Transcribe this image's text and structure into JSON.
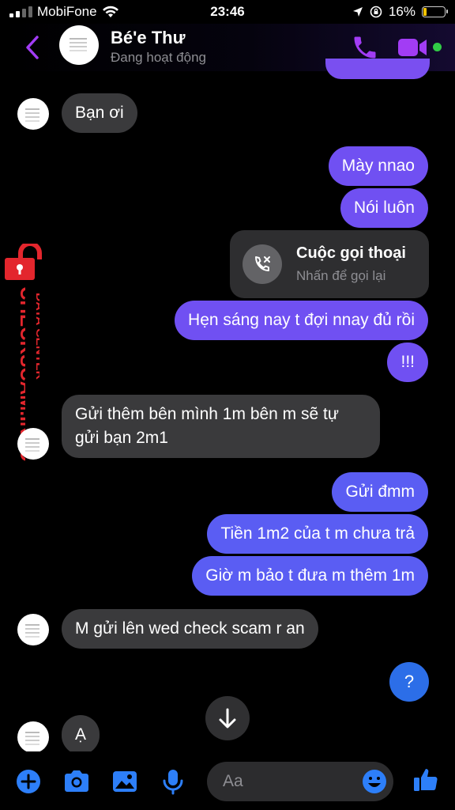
{
  "status_bar": {
    "carrier": "MobiFone",
    "time": "23:46",
    "battery": "16%",
    "battery_color": "#f5c400",
    "icons": [
      "signal-icon",
      "wifi-icon",
      "location-icon",
      "orientation-lock-icon",
      "battery-icon"
    ]
  },
  "header": {
    "name": "Bé'e Thư",
    "status": "Đang hoạt động",
    "accent": "#a23cf5",
    "online_color": "#31cc46",
    "icons": [
      "back-icon",
      "phone-icon",
      "video-icon"
    ]
  },
  "messages": [
    {
      "side": "in",
      "text": "Bạn ơi"
    },
    {
      "side": "out",
      "text": "Mày nnao"
    },
    {
      "side": "out",
      "text": "Nói luôn"
    },
    {
      "side": "out",
      "type": "call",
      "title": "Cuộc gọi thoại",
      "subtitle": "Nhấn để gọi lại"
    },
    {
      "side": "out",
      "text": "Hẹn sáng nay t đợi nnay đủ rồi"
    },
    {
      "side": "out",
      "text": "!!!"
    },
    {
      "side": "in",
      "lines": [
        "Gửi thêm bên mình 1m bên m sẽ tự",
        "gửi bạn 2m1"
      ]
    },
    {
      "side": "out",
      "text": "Gửi đmm"
    },
    {
      "side": "out",
      "text": "Tiền 1m2 của t m chưa trả"
    },
    {
      "side": "out",
      "text": "Giờ m bảo t đưa m thêm 1m"
    },
    {
      "side": "in",
      "text": "M gửi lên wed check scam r an"
    },
    {
      "side": "out",
      "text": "?"
    },
    {
      "side": "in",
      "text": "Ạ"
    }
  ],
  "watermark": {
    "title": "CHECKSCAM.INFO",
    "subtitle": "DATA CENTER",
    "color": "#e3262d"
  },
  "composer": {
    "placeholder": "Aa",
    "icons": [
      "plus-icon",
      "camera-icon",
      "image-icon",
      "mic-icon",
      "emoji-icon",
      "like-icon"
    ],
    "accent": "#2d7ff9"
  },
  "scroll_down_icon": "arrow-down-icon"
}
